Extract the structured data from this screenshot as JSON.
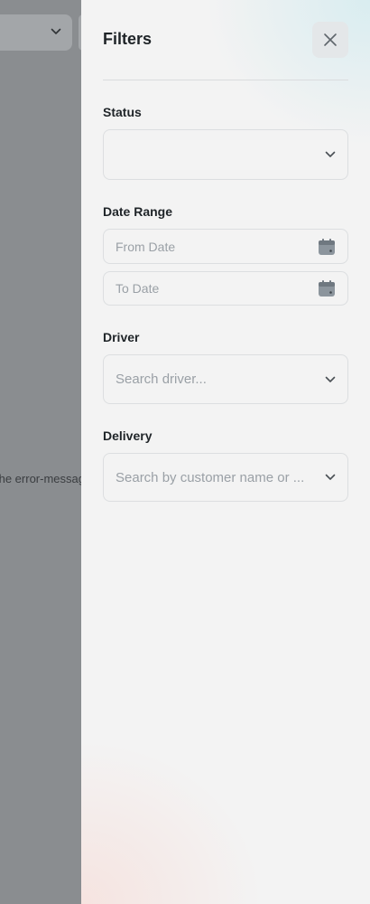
{
  "background": {
    "error_text": "the error-message"
  },
  "drawer": {
    "title": "Filters",
    "status": {
      "label": "Status",
      "value": ""
    },
    "date_range": {
      "label": "Date Range",
      "from_placeholder": "From Date",
      "to_placeholder": "To Date"
    },
    "driver": {
      "label": "Driver",
      "placeholder": "Search driver..."
    },
    "delivery": {
      "label": "Delivery",
      "placeholder": "Search by customer name or ..."
    }
  },
  "colors": {
    "overlay": "#8a8d90",
    "drawer_bg": "#f3f3f3",
    "border": "#dcdee0",
    "placeholder": "#9aa0a6",
    "heading": "#1f2428",
    "calendar_icon": "#8c959d"
  },
  "icons": {
    "close": "close-icon",
    "chevron": "chevron-down-icon",
    "calendar": "calendar-icon"
  }
}
